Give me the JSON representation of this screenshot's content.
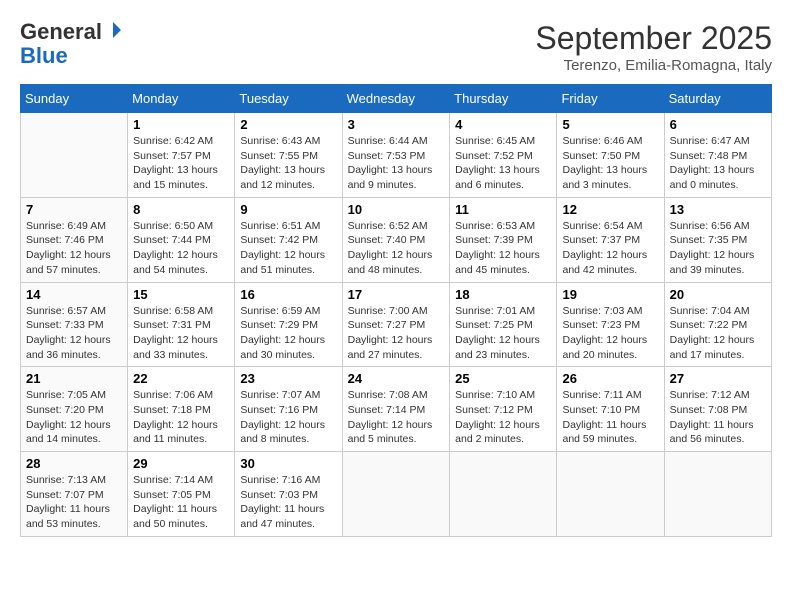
{
  "header": {
    "logo_line1": "General",
    "logo_line2": "Blue",
    "month_title": "September 2025",
    "location": "Terenzo, Emilia-Romagna, Italy"
  },
  "weekdays": [
    "Sunday",
    "Monday",
    "Tuesday",
    "Wednesday",
    "Thursday",
    "Friday",
    "Saturday"
  ],
  "weeks": [
    [
      {
        "day": "",
        "sunrise": "",
        "sunset": "",
        "daylight": ""
      },
      {
        "day": "1",
        "sunrise": "Sunrise: 6:42 AM",
        "sunset": "Sunset: 7:57 PM",
        "daylight": "Daylight: 13 hours and 15 minutes."
      },
      {
        "day": "2",
        "sunrise": "Sunrise: 6:43 AM",
        "sunset": "Sunset: 7:55 PM",
        "daylight": "Daylight: 13 hours and 12 minutes."
      },
      {
        "day": "3",
        "sunrise": "Sunrise: 6:44 AM",
        "sunset": "Sunset: 7:53 PM",
        "daylight": "Daylight: 13 hours and 9 minutes."
      },
      {
        "day": "4",
        "sunrise": "Sunrise: 6:45 AM",
        "sunset": "Sunset: 7:52 PM",
        "daylight": "Daylight: 13 hours and 6 minutes."
      },
      {
        "day": "5",
        "sunrise": "Sunrise: 6:46 AM",
        "sunset": "Sunset: 7:50 PM",
        "daylight": "Daylight: 13 hours and 3 minutes."
      },
      {
        "day": "6",
        "sunrise": "Sunrise: 6:47 AM",
        "sunset": "Sunset: 7:48 PM",
        "daylight": "Daylight: 13 hours and 0 minutes."
      }
    ],
    [
      {
        "day": "7",
        "sunrise": "Sunrise: 6:49 AM",
        "sunset": "Sunset: 7:46 PM",
        "daylight": "Daylight: 12 hours and 57 minutes."
      },
      {
        "day": "8",
        "sunrise": "Sunrise: 6:50 AM",
        "sunset": "Sunset: 7:44 PM",
        "daylight": "Daylight: 12 hours and 54 minutes."
      },
      {
        "day": "9",
        "sunrise": "Sunrise: 6:51 AM",
        "sunset": "Sunset: 7:42 PM",
        "daylight": "Daylight: 12 hours and 51 minutes."
      },
      {
        "day": "10",
        "sunrise": "Sunrise: 6:52 AM",
        "sunset": "Sunset: 7:40 PM",
        "daylight": "Daylight: 12 hours and 48 minutes."
      },
      {
        "day": "11",
        "sunrise": "Sunrise: 6:53 AM",
        "sunset": "Sunset: 7:39 PM",
        "daylight": "Daylight: 12 hours and 45 minutes."
      },
      {
        "day": "12",
        "sunrise": "Sunrise: 6:54 AM",
        "sunset": "Sunset: 7:37 PM",
        "daylight": "Daylight: 12 hours and 42 minutes."
      },
      {
        "day": "13",
        "sunrise": "Sunrise: 6:56 AM",
        "sunset": "Sunset: 7:35 PM",
        "daylight": "Daylight: 12 hours and 39 minutes."
      }
    ],
    [
      {
        "day": "14",
        "sunrise": "Sunrise: 6:57 AM",
        "sunset": "Sunset: 7:33 PM",
        "daylight": "Daylight: 12 hours and 36 minutes."
      },
      {
        "day": "15",
        "sunrise": "Sunrise: 6:58 AM",
        "sunset": "Sunset: 7:31 PM",
        "daylight": "Daylight: 12 hours and 33 minutes."
      },
      {
        "day": "16",
        "sunrise": "Sunrise: 6:59 AM",
        "sunset": "Sunset: 7:29 PM",
        "daylight": "Daylight: 12 hours and 30 minutes."
      },
      {
        "day": "17",
        "sunrise": "Sunrise: 7:00 AM",
        "sunset": "Sunset: 7:27 PM",
        "daylight": "Daylight: 12 hours and 27 minutes."
      },
      {
        "day": "18",
        "sunrise": "Sunrise: 7:01 AM",
        "sunset": "Sunset: 7:25 PM",
        "daylight": "Daylight: 12 hours and 23 minutes."
      },
      {
        "day": "19",
        "sunrise": "Sunrise: 7:03 AM",
        "sunset": "Sunset: 7:23 PM",
        "daylight": "Daylight: 12 hours and 20 minutes."
      },
      {
        "day": "20",
        "sunrise": "Sunrise: 7:04 AM",
        "sunset": "Sunset: 7:22 PM",
        "daylight": "Daylight: 12 hours and 17 minutes."
      }
    ],
    [
      {
        "day": "21",
        "sunrise": "Sunrise: 7:05 AM",
        "sunset": "Sunset: 7:20 PM",
        "daylight": "Daylight: 12 hours and 14 minutes."
      },
      {
        "day": "22",
        "sunrise": "Sunrise: 7:06 AM",
        "sunset": "Sunset: 7:18 PM",
        "daylight": "Daylight: 12 hours and 11 minutes."
      },
      {
        "day": "23",
        "sunrise": "Sunrise: 7:07 AM",
        "sunset": "Sunset: 7:16 PM",
        "daylight": "Daylight: 12 hours and 8 minutes."
      },
      {
        "day": "24",
        "sunrise": "Sunrise: 7:08 AM",
        "sunset": "Sunset: 7:14 PM",
        "daylight": "Daylight: 12 hours and 5 minutes."
      },
      {
        "day": "25",
        "sunrise": "Sunrise: 7:10 AM",
        "sunset": "Sunset: 7:12 PM",
        "daylight": "Daylight: 12 hours and 2 minutes."
      },
      {
        "day": "26",
        "sunrise": "Sunrise: 7:11 AM",
        "sunset": "Sunset: 7:10 PM",
        "daylight": "Daylight: 11 hours and 59 minutes."
      },
      {
        "day": "27",
        "sunrise": "Sunrise: 7:12 AM",
        "sunset": "Sunset: 7:08 PM",
        "daylight": "Daylight: 11 hours and 56 minutes."
      }
    ],
    [
      {
        "day": "28",
        "sunrise": "Sunrise: 7:13 AM",
        "sunset": "Sunset: 7:07 PM",
        "daylight": "Daylight: 11 hours and 53 minutes."
      },
      {
        "day": "29",
        "sunrise": "Sunrise: 7:14 AM",
        "sunset": "Sunset: 7:05 PM",
        "daylight": "Daylight: 11 hours and 50 minutes."
      },
      {
        "day": "30",
        "sunrise": "Sunrise: 7:16 AM",
        "sunset": "Sunset: 7:03 PM",
        "daylight": "Daylight: 11 hours and 47 minutes."
      },
      {
        "day": "",
        "sunrise": "",
        "sunset": "",
        "daylight": ""
      },
      {
        "day": "",
        "sunrise": "",
        "sunset": "",
        "daylight": ""
      },
      {
        "day": "",
        "sunrise": "",
        "sunset": "",
        "daylight": ""
      },
      {
        "day": "",
        "sunrise": "",
        "sunset": "",
        "daylight": ""
      }
    ]
  ]
}
